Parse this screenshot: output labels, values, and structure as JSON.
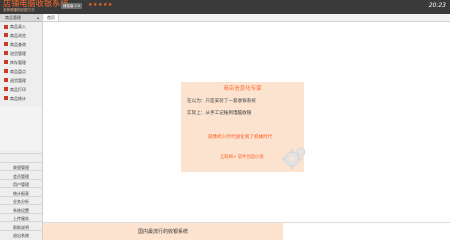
{
  "header": {
    "brand_title": "店铺电脑收银系统",
    "brand_subtitle": "多种便捷的收银方式",
    "version_badge": "绿色版 2.0",
    "stars": "★★★★★",
    "clock": "20:23"
  },
  "sidebar": {
    "header_label": "商品管理",
    "top_items": [
      {
        "label": "商品录入"
      },
      {
        "label": "商品浏览"
      },
      {
        "label": "商品查询"
      },
      {
        "label": "进货管理"
      },
      {
        "label": "库存管理"
      },
      {
        "label": "商品盘点"
      },
      {
        "label": "退货管理"
      },
      {
        "label": "商品打印"
      },
      {
        "label": "商品统计"
      }
    ],
    "bottom_items": [
      {
        "label": "收银管理"
      },
      {
        "label": "会员管理"
      },
      {
        "label": "用户管理"
      },
      {
        "label": "统计报表"
      },
      {
        "label": "业务分析"
      },
      {
        "label": "系统设置"
      },
      {
        "label": "上传服务"
      },
      {
        "label": "帮助说明"
      },
      {
        "label": "退出系统"
      }
    ]
  },
  "main": {
    "tab_home": "首页",
    "promo": {
      "title": "商店信息化专家",
      "line1_lead": "在以为：",
      "line1_rest": "只是安装了一套收银系统",
      "line2_lead": "实际上：",
      "line2_rest": "从手工记账到电脑收银",
      "emphasis": "就像跨入时代进化到了机械时代",
      "footer": "互联网+  软件创造价值"
    },
    "status_text": "国内最流行的收银系统"
  },
  "colors": {
    "header_bg": "#3a3a3a",
    "accent": "#ff6a2a",
    "menu_icon": "#cc3a2a",
    "promo_bg": "#fbe3d0"
  },
  "icons": {
    "menu_item": "red-square-icon",
    "collapse": "collapse-icon",
    "promo_decor": "gears-icon"
  }
}
